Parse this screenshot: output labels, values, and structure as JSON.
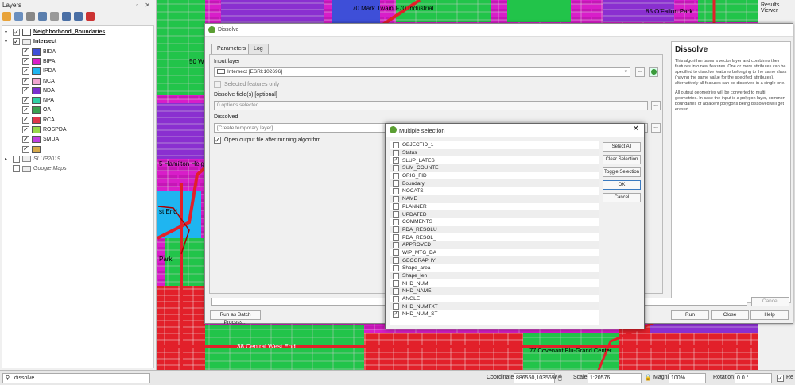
{
  "layers_panel": {
    "title": "Layers",
    "hdr_buttons": "▫ ✕",
    "layers": [
      {
        "name": "Neighborhood_Boundaries",
        "checked": true,
        "swatch": "#ffffff",
        "indent": 1,
        "expander": "▾"
      },
      {
        "name": "Intersect",
        "checked": true,
        "indent": 1,
        "expander": "▾"
      },
      {
        "name": "BIDA",
        "checked": true,
        "swatch": "#3e4fd8",
        "indent": 2
      },
      {
        "name": "BIPA",
        "checked": true,
        "swatch": "#d81ec9",
        "indent": 2
      },
      {
        "name": "IPDA",
        "checked": true,
        "swatch": "#1fb5f0",
        "indent": 2
      },
      {
        "name": "NCA",
        "checked": true,
        "swatch": "#f0a5d0",
        "indent": 2
      },
      {
        "name": "NDA",
        "checked": true,
        "swatch": "#7a2fd0",
        "indent": 2
      },
      {
        "name": "NPA",
        "checked": true,
        "swatch": "#2fd0a5",
        "indent": 2
      },
      {
        "name": "OA",
        "checked": true,
        "swatch": "#3aa050",
        "indent": 2
      },
      {
        "name": "RCA",
        "checked": true,
        "swatch": "#e0364a",
        "indent": 2
      },
      {
        "name": "ROSPDA",
        "checked": true,
        "swatch": "#98d84a",
        "indent": 2
      },
      {
        "name": "SMUA",
        "checked": true,
        "swatch": "#c040e0",
        "indent": 2
      },
      {
        "name": "",
        "checked": true,
        "swatch": "#d6a94a",
        "indent": 2
      },
      {
        "name": "SLUP2019",
        "checked": false,
        "indent": 1,
        "italic": true,
        "expander": "▸"
      },
      {
        "name": "Google Maps",
        "checked": false,
        "indent": 1,
        "italic": true,
        "expander": ""
      }
    ]
  },
  "map": {
    "labels": [
      {
        "text": "70 Mark Twain I-70 Industrial"
      },
      {
        "text": "85 O'Fallon Park"
      },
      {
        "text": "38 Central West End"
      },
      {
        "text": "77 Covenant Blu-Grand Center"
      },
      {
        "text": "5 Hamilton Height"
      },
      {
        "text": "50 W"
      },
      {
        "text": "st End"
      },
      {
        "text": "Park"
      }
    ]
  },
  "results_viewer": {
    "title": "Results Viewer"
  },
  "dissolve": {
    "title": "Dissolve",
    "tabs": [
      "Parameters",
      "Log"
    ],
    "input_layer_label": "Input layer",
    "input_layer_value": "Intersect [ESRI:102696]",
    "selected_only": "Selected features only",
    "dissolve_fields_label": "Dissolve field(s) [optional]",
    "dissolve_fields_value": "0 options selected",
    "dissolved_label": "Dissolved",
    "dissolved_placeholder": "[Create temporary layer]",
    "open_output": "Open output file after running algorithm",
    "help_title": "Dissolve",
    "help_p1": "This algorithm takes a vector layer and combines their features into new features. One or more attributes can be specified to dissolve features belonging to the same class (having the same value for the specified attributes), alternatively all features can be dissolved in a single one.",
    "help_p2": "All output geometries will be converted to multi geometries. In case the input is a polygon layer, common boundaries of adjacent polygons being dissolved will get erased.",
    "batch_button": "Run as Batch Process...",
    "cancel_button": "Cancel",
    "run_button": "Run",
    "close_button": "Close",
    "help_button": "Help",
    "ellipsis": "..."
  },
  "multi": {
    "title": "Multiple selection",
    "close": "✕",
    "items": [
      {
        "label": "OBJECTID_1",
        "checked": false
      },
      {
        "label": "Status",
        "checked": false
      },
      {
        "label": "SLUP_LATES",
        "checked": true
      },
      {
        "label": "SUM_COUNTE",
        "checked": false
      },
      {
        "label": "ORIG_FID",
        "checked": false
      },
      {
        "label": "Boundary",
        "checked": false
      },
      {
        "label": "NOCATS",
        "checked": false
      },
      {
        "label": "NAME",
        "checked": false
      },
      {
        "label": "PLANNER",
        "checked": false
      },
      {
        "label": "UPDATED",
        "checked": false
      },
      {
        "label": "COMMENTS",
        "checked": false
      },
      {
        "label": "PDA_RESOLU",
        "checked": false
      },
      {
        "label": "PDA_RESOL_",
        "checked": false
      },
      {
        "label": "APPROVED",
        "checked": false
      },
      {
        "label": "WIP_MTG_DA",
        "checked": false
      },
      {
        "label": "GEOGRAPHY",
        "checked": false
      },
      {
        "label": "Shape_area",
        "checked": false
      },
      {
        "label": "Shape_len",
        "checked": false
      },
      {
        "label": "NHD_NUM",
        "checked": false
      },
      {
        "label": "NHD_NAME",
        "checked": false
      },
      {
        "label": "ANGLE",
        "checked": false
      },
      {
        "label": "NHD_NUMTXT",
        "checked": false
      },
      {
        "label": "NHD_NUM_ST",
        "checked": true
      }
    ],
    "select_all": "Select All",
    "clear_selection": "Clear Selection",
    "toggle_selection": "Toggle Selection",
    "ok": "OK",
    "cancel": "Cancel"
  },
  "status": {
    "search_value": "dissolve",
    "coordinate_label": "Coordinate",
    "coordinate_value": "886550,1035696",
    "scale_label": "Scale",
    "scale_value": "1:20576",
    "magnifier_label": "Magnifier",
    "magnifier_value": "100%",
    "rotation_label": "Rotation",
    "rotation_value": "0.0 °",
    "render_label": "Re"
  },
  "colors": {
    "magenta": "#d81ec9",
    "green": "#22c44a",
    "red": "#e2202a",
    "purple": "#8a2fd0",
    "cyan": "#1fb5f0"
  }
}
